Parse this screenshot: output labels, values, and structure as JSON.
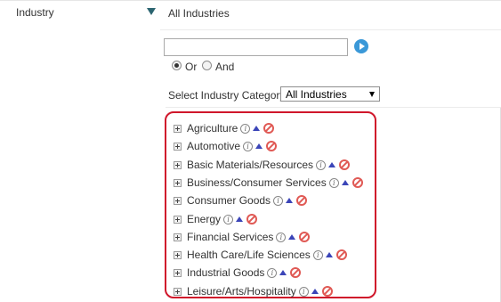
{
  "filter": {
    "field_label": "Industry",
    "selected_summary": "All Industries"
  },
  "search": {
    "value": "",
    "placeholder": ""
  },
  "match_mode": {
    "options": [
      {
        "label": "Or",
        "checked": true
      },
      {
        "label": "And",
        "checked": false
      }
    ]
  },
  "category": {
    "label": "Select Industry Category",
    "selected": "All Industries"
  },
  "industries": [
    {
      "label": "Agriculture"
    },
    {
      "label": "Automotive"
    },
    {
      "label": "Basic Materials/Resources"
    },
    {
      "label": "Business/Consumer Services"
    },
    {
      "label": "Consumer Goods"
    },
    {
      "label": "Energy"
    },
    {
      "label": "Financial Services"
    },
    {
      "label": "Health Care/Life Sciences"
    },
    {
      "label": "Industrial Goods"
    },
    {
      "label": "Leisure/Arts/Hospitality"
    }
  ],
  "icons": {
    "expand": "plus-box-icon",
    "info": "info-icon",
    "include": "up-triangle-icon",
    "exclude": "block-icon",
    "go": "play-circle-icon",
    "collapse": "triangle-down-icon"
  },
  "colors": {
    "highlight": "#d0172b",
    "go_button": "#3a98d8",
    "include_icon": "#3b45b8",
    "exclude_icon": "#e05a55",
    "collapse_arrow": "#2b6470"
  }
}
